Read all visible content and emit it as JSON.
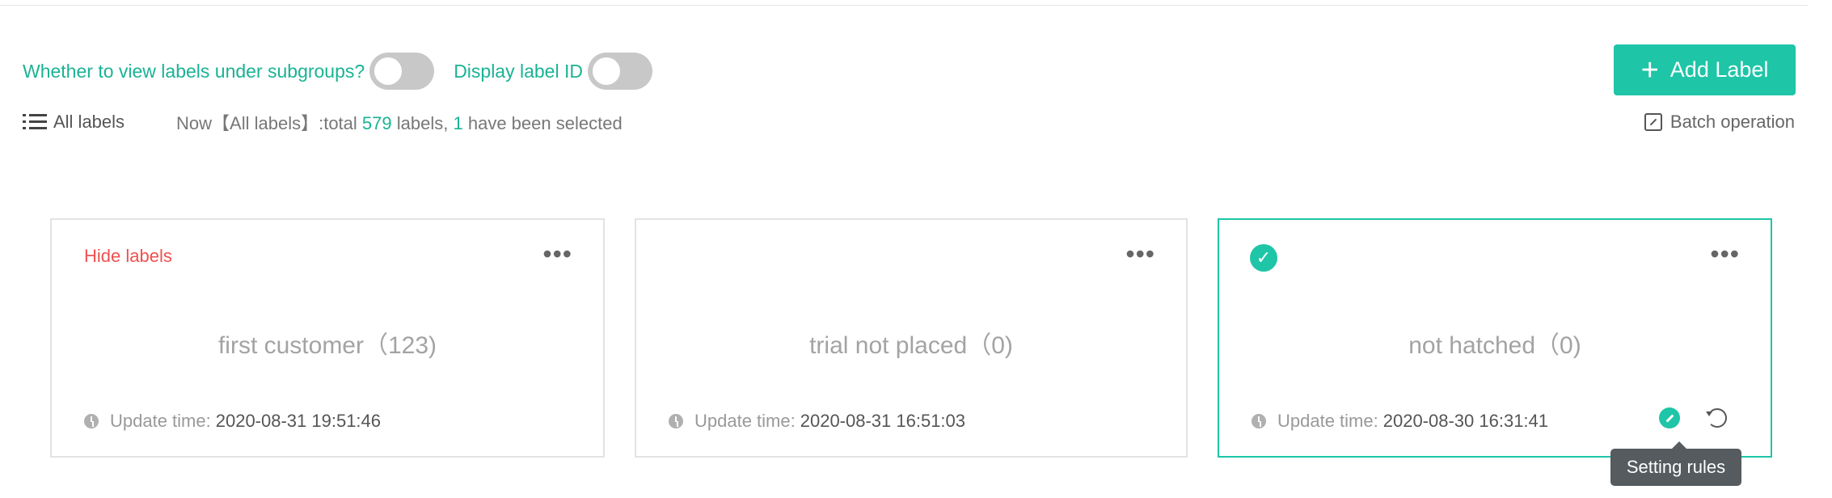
{
  "filters": {
    "subgroups_label": "Whether to view labels under subgroups?",
    "subgroups_on": false,
    "display_id_label": "Display label ID",
    "display_id_on": false
  },
  "add_button": {
    "icon": "plus-icon",
    "label": "Add Label"
  },
  "summary": {
    "all_labels": "All labels",
    "status_prefix": "Now【All labels】:total",
    "total": "579",
    "status_mid": "labels,",
    "selected": "1",
    "status_suffix": "have been selected"
  },
  "batch": {
    "icon": "batch-edit-icon",
    "label": "Batch operation"
  },
  "cards": [
    {
      "tag": "Hide labels",
      "name": "first customer（123)",
      "time_label": "Update time:",
      "time": "2020-08-31 19:51:46",
      "selected": false
    },
    {
      "tag": "",
      "name": "trial not placed（0)",
      "time_label": "Update time:",
      "time": "2020-08-31 16:51:03",
      "selected": false
    },
    {
      "tag": "",
      "name": "not hatched（0)",
      "time_label": "Update time:",
      "time": "2020-08-30 16:31:41",
      "selected": true
    }
  ],
  "tooltip": "Setting rules",
  "colors": {
    "accent": "#1ec5a7",
    "hidden": "#f05050",
    "toggle_off": "#c8c8c8"
  }
}
